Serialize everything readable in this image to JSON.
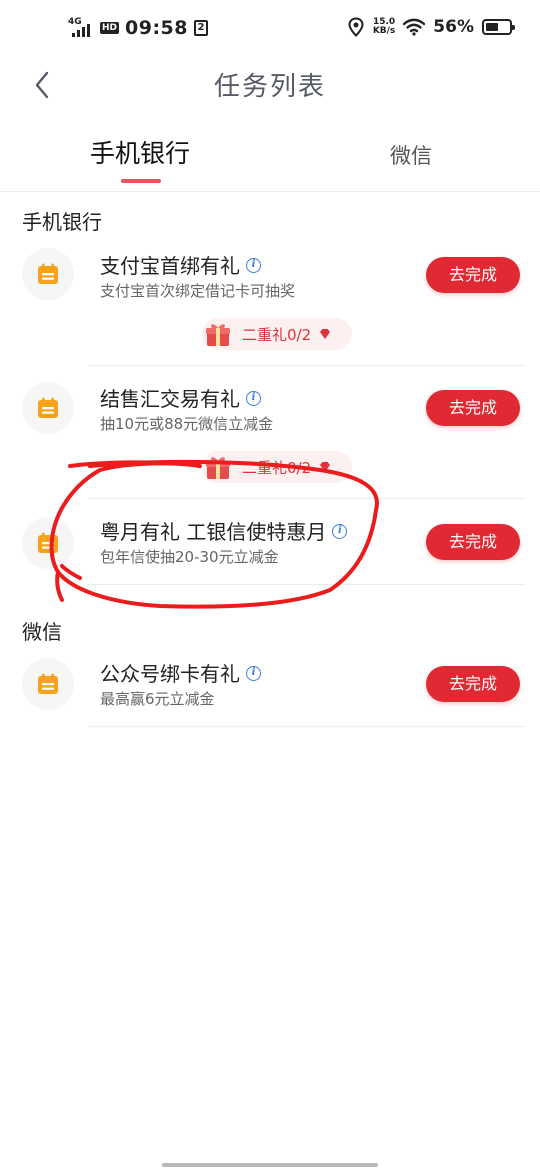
{
  "status_bar": {
    "network": "4G",
    "hd": "HD",
    "time": "09:58",
    "sim": "2",
    "speed_value": "15.0",
    "speed_unit": "KB/s",
    "battery_percent": "56%",
    "battery_level": 0.56
  },
  "header": {
    "title": "任务列表",
    "back_icon": "chevron-left-icon"
  },
  "tabs": [
    {
      "label": "手机银行",
      "active": true
    },
    {
      "label": "微信",
      "active": false
    }
  ],
  "accent_color": "#e02933",
  "sections": [
    {
      "title": "手机银行",
      "tasks": [
        {
          "title": "支付宝首绑有礼",
          "desc": "支付宝首次绑定借记卡可抽奖",
          "button": "去完成",
          "reward": "二重礼0/2"
        },
        {
          "title": "结售汇交易有礼",
          "desc": "抽10元或88元微信立减金",
          "button": "去完成",
          "reward": "二重礼0/2"
        },
        {
          "title": "粤月有礼 工银信使特惠月",
          "desc": "包年信使抽20-30元立减金",
          "button": "去完成"
        }
      ]
    },
    {
      "title": "微信",
      "tasks": [
        {
          "title": "公众号绑卡有礼",
          "desc": "最高赢6元立减金",
          "button": "去完成"
        }
      ]
    }
  ]
}
